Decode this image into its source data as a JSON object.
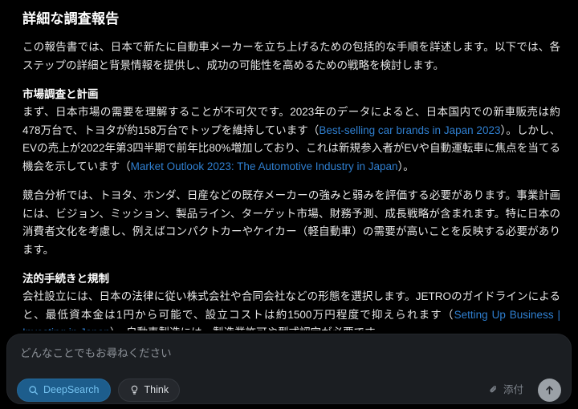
{
  "theme": {
    "background": "#000000",
    "text": "#e6e6e6",
    "link": "#2f7fd0",
    "composer_bg": "#1b1e22",
    "deepsearch_bg": "#1d5d8c",
    "deepsearch_fg": "#74c2f0",
    "think_bg": "#25282d",
    "send_bg": "#9ba1a7"
  },
  "document": {
    "title": "詳細な調査報告",
    "intro": "この報告書では、日本で新たに自動車メーカーを立ち上げるための包括的な手順を詳述します。以下では、各ステップの詳細と背景情報を提供し、成功の可能性を高めるための戦略を検討します。",
    "sections": [
      {
        "heading": "市場調査と計画",
        "paragraphs": [
          {
            "runs": [
              {
                "type": "text",
                "value": "まず、日本市場の需要を理解することが不可欠です。2023年のデータによると、日本国内での新車販売は約478万台で、トヨタが約158万台でトップを維持しています（"
              },
              {
                "type": "link",
                "value": "Best-selling car brands in Japan 2023"
              },
              {
                "type": "text",
                "value": "）。しかし、EVの売上が2022年第3四半期で前年比80%増加しており、これは新規参入者がEVや自動運転車に焦点を当てる機会を示しています（"
              },
              {
                "type": "link",
                "value": "Market Outlook 2023: The Automotive Industry in Japan"
              },
              {
                "type": "text",
                "value": "）。"
              }
            ]
          },
          {
            "runs": [
              {
                "type": "text",
                "value": "競合分析では、トヨタ、ホンダ、日産などの既存メーカーの強みと弱みを評価する必要があります。事業計画には、ビジョン、ミッション、製品ライン、ターゲット市場、財務予測、成長戦略が含まれます。特に日本の消費者文化を考慮し、例えばコンパクトカーやケイカー（軽自動車）の需要が高いことを反映する必要があります。"
              }
            ]
          }
        ]
      },
      {
        "heading": "法的手続きと規制",
        "paragraphs": [
          {
            "runs": [
              {
                "type": "text",
                "value": "会社設立には、日本の法律に従い株式会社や合同会社などの形態を選択します。JETROのガイドラインによると、最低資本金は1円から可能で、設立コストは約1500万円程度で抑えられます（"
              },
              {
                "type": "link",
                "value": "Setting Up Business | Investing in Japan"
              },
              {
                "type": "text",
                "value": "）。自動車製造には、製造業許可や型式認定が必要です。"
              }
            ]
          }
        ]
      }
    ]
  },
  "composer": {
    "placeholder": "どんなことでもお尋ねください",
    "value": "",
    "deepsearch_label": "DeepSearch",
    "think_label": "Think",
    "attach_label": "添付"
  }
}
